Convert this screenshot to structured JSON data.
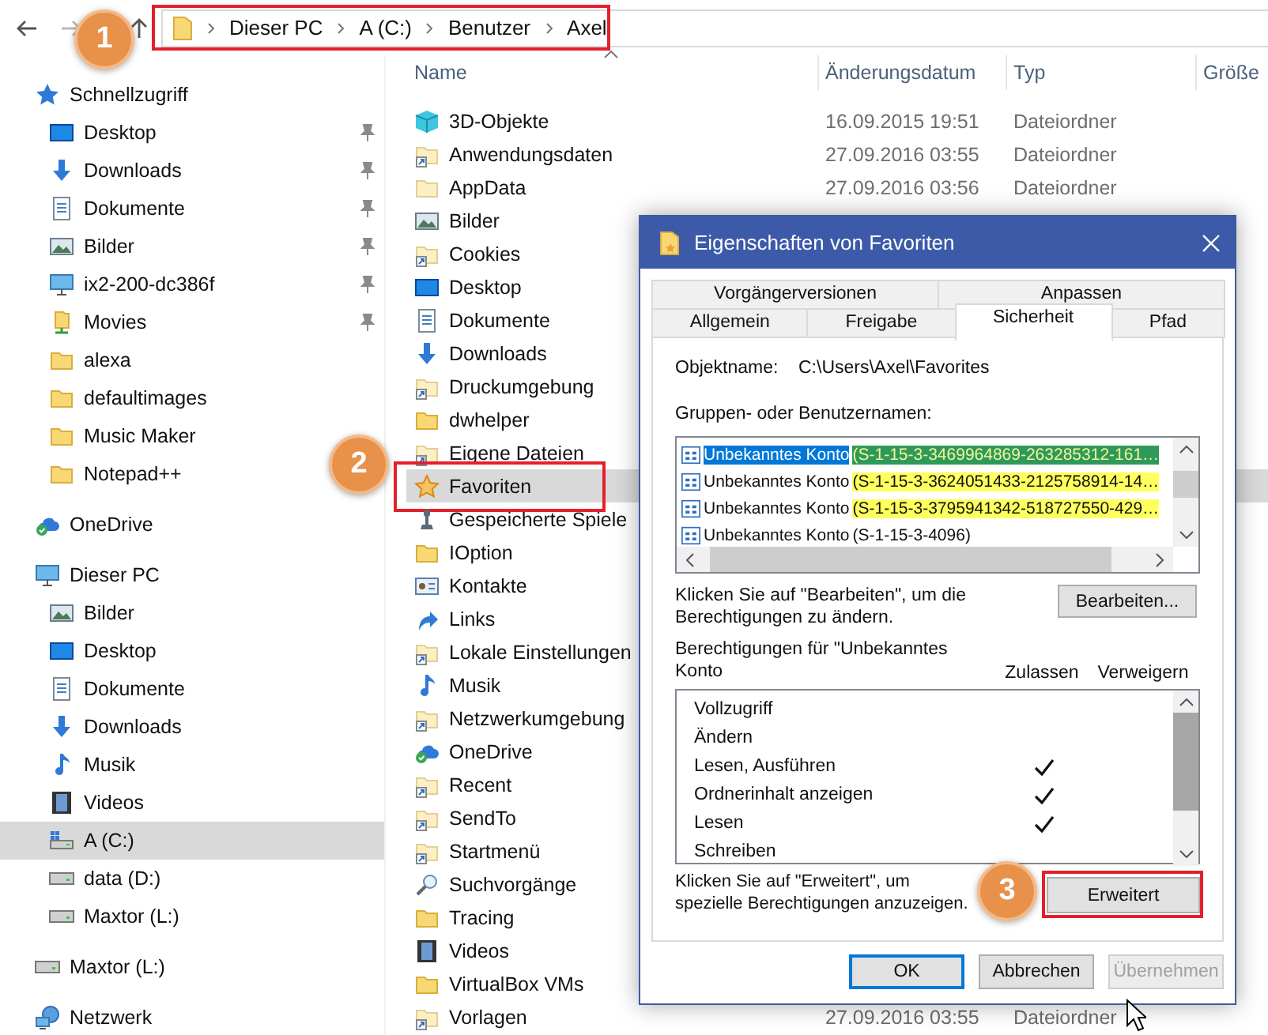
{
  "address_bar": {
    "crumbs": [
      "Dieser PC",
      "A (C:)",
      "Benutzer",
      "Axel"
    ],
    "callout": "1"
  },
  "sidebar": {
    "sections": [
      {
        "label": "Schnellzugriff",
        "kind": "quick-access",
        "selected": false,
        "children": [
          {
            "label": "Desktop",
            "kind": "desktop",
            "pinned": true,
            "selected": false
          },
          {
            "label": "Downloads",
            "kind": "downloads",
            "pinned": true,
            "selected": false
          },
          {
            "label": "Dokumente",
            "kind": "documents",
            "pinned": true,
            "selected": false
          },
          {
            "label": "Bilder",
            "kind": "pictures",
            "pinned": true,
            "selected": false
          },
          {
            "label": "ix2-200-dc386f",
            "kind": "computer",
            "pinned": true,
            "selected": false
          },
          {
            "label": "Movies",
            "kind": "network-folder",
            "pinned": true,
            "selected": false
          },
          {
            "label": "alexa",
            "kind": "folder",
            "pinned": false,
            "selected": false
          },
          {
            "label": "defaultimages",
            "kind": "folder",
            "pinned": false,
            "selected": false
          },
          {
            "label": "Music Maker",
            "kind": "folder",
            "pinned": false,
            "selected": false
          },
          {
            "label": "Notepad++",
            "kind": "folder",
            "pinned": false,
            "selected": false
          }
        ]
      },
      {
        "label": "OneDrive",
        "kind": "cloud",
        "selected": false
      },
      {
        "label": "Dieser PC",
        "kind": "computer",
        "selected": false,
        "children": [
          {
            "label": "Bilder",
            "kind": "pictures",
            "pinned": false,
            "selected": false
          },
          {
            "label": "Desktop",
            "kind": "desktop",
            "pinned": false,
            "selected": false
          },
          {
            "label": "Dokumente",
            "kind": "documents",
            "pinned": false,
            "selected": false
          },
          {
            "label": "Downloads",
            "kind": "downloads",
            "pinned": false,
            "selected": false
          },
          {
            "label": "Musik",
            "kind": "music",
            "pinned": false,
            "selected": false
          },
          {
            "label": "Videos",
            "kind": "videos",
            "pinned": false,
            "selected": false
          },
          {
            "label": "A (C:)",
            "kind": "system-drive",
            "pinned": false,
            "selected": true
          },
          {
            "label": "data (D:)",
            "kind": "drive",
            "pinned": false,
            "selected": false
          },
          {
            "label": "Maxtor (L:)",
            "kind": "drive",
            "pinned": false,
            "selected": false
          }
        ]
      },
      {
        "label": "Maxtor (L:)",
        "kind": "drive",
        "selected": false
      },
      {
        "label": "Netzwerk",
        "kind": "network",
        "selected": false
      }
    ]
  },
  "file_list": {
    "columns": [
      "Name",
      "Änderungsdatum",
      "Typ",
      "Größe"
    ],
    "rows": [
      {
        "name": "3D-Objekte",
        "kind": "cube",
        "date": "16.09.2015 19:51",
        "type": "Dateiordner",
        "selected": false
      },
      {
        "name": "Anwendungsdaten",
        "kind": "shortcut",
        "date": "27.09.2016 03:55",
        "type": "Dateiordner",
        "selected": false
      },
      {
        "name": "AppData",
        "kind": "hidden-folder",
        "date": "27.09.2016 03:56",
        "type": "Dateiordner",
        "selected": false
      },
      {
        "name": "Bilder",
        "kind": "pictures",
        "selected": false
      },
      {
        "name": "Cookies",
        "kind": "shortcut",
        "selected": false
      },
      {
        "name": "Desktop",
        "kind": "desktop",
        "selected": false
      },
      {
        "name": "Dokumente",
        "kind": "documents",
        "selected": false
      },
      {
        "name": "Downloads",
        "kind": "downloads",
        "selected": false
      },
      {
        "name": "Druckumgebung",
        "kind": "shortcut",
        "selected": false
      },
      {
        "name": "dwhelper",
        "kind": "folder",
        "selected": false
      },
      {
        "name": "Eigene Dateien",
        "kind": "shortcut",
        "selected": false
      },
      {
        "name": "Favoriten",
        "kind": "favorites",
        "selected": true,
        "callout": "2"
      },
      {
        "name": "Gespeicherte Spiele",
        "kind": "games",
        "selected": false
      },
      {
        "name": "IOption",
        "kind": "folder",
        "selected": false
      },
      {
        "name": "Kontakte",
        "kind": "contacts",
        "selected": false
      },
      {
        "name": "Links",
        "kind": "links",
        "selected": false
      },
      {
        "name": "Lokale Einstellungen",
        "kind": "shortcut",
        "selected": false
      },
      {
        "name": "Musik",
        "kind": "music",
        "selected": false
      },
      {
        "name": "Netzwerkumgebung",
        "kind": "shortcut",
        "selected": false
      },
      {
        "name": "OneDrive",
        "kind": "cloud",
        "selected": false
      },
      {
        "name": "Recent",
        "kind": "shortcut",
        "selected": false
      },
      {
        "name": "SendTo",
        "kind": "shortcut",
        "selected": false
      },
      {
        "name": "Startmenü",
        "kind": "shortcut",
        "selected": false
      },
      {
        "name": "Suchvorgänge",
        "kind": "search",
        "selected": false
      },
      {
        "name": "Tracing",
        "kind": "folder",
        "selected": false
      },
      {
        "name": "Videos",
        "kind": "videos",
        "selected": false
      },
      {
        "name": "VirtualBox VMs",
        "kind": "folder",
        "selected": false
      },
      {
        "name": "Vorlagen",
        "kind": "shortcut",
        "date": "27.09.2016 03:55",
        "type": "Dateiordner",
        "selected": false
      }
    ]
  },
  "dialog": {
    "title": "Eigenschaften von Favoriten",
    "tab_rows": [
      [
        {
          "label": "Vorgängerversionen",
          "selected": false
        },
        {
          "label": "Anpassen",
          "selected": false
        }
      ],
      [
        {
          "label": "Allgemein",
          "selected": false
        },
        {
          "label": "Freigabe",
          "selected": false
        },
        {
          "label": "Sicherheit",
          "selected": true
        },
        {
          "label": "Pfad",
          "selected": false
        }
      ]
    ],
    "object_label": "Objektname:",
    "object_value": "C:\\Users\\Axel\\Favorites",
    "groups_label": "Gruppen- oder Benutzernamen:",
    "accounts": [
      {
        "name": "Unbekanntes Konto",
        "sid": "(S-1-15-3-3469964869-263285312-161…",
        "selected": true,
        "marked": true
      },
      {
        "name": "Unbekanntes Konto",
        "sid": "(S-1-15-3-3624051433-2125758914-14…",
        "selected": false,
        "marked": true
      },
      {
        "name": "Unbekanntes Konto",
        "sid": "(S-1-15-3-3795941342-518727550-429…",
        "selected": false,
        "marked": true
      },
      {
        "name": "Unbekanntes Konto",
        "sid": "(S-1-15-3-4096)",
        "selected": false,
        "marked": false
      }
    ],
    "edit_hint": "Klicken Sie auf \"Bearbeiten\", um die Berechtigungen zu ändern.",
    "edit_button": "Bearbeiten...",
    "permissions_label": "Berechtigungen für \"Unbekanntes Konto",
    "allow_header": "Zulassen",
    "deny_header": "Verweigern",
    "permissions": [
      {
        "name": "Vollzugriff",
        "allow": false,
        "deny": false
      },
      {
        "name": "Ändern",
        "allow": false,
        "deny": false
      },
      {
        "name": "Lesen, Ausführen",
        "allow": true,
        "deny": false
      },
      {
        "name": "Ordnerinhalt anzeigen",
        "allow": true,
        "deny": false
      },
      {
        "name": "Lesen",
        "allow": true,
        "deny": false
      },
      {
        "name": "Schreiben",
        "allow": false,
        "deny": false
      }
    ],
    "advanced_hint": "Klicken Sie auf \"Erweitert\", um spezielle Berechtigungen anzuzeigen.",
    "advanced_button": {
      "label": "Erweitert",
      "callout": "3"
    },
    "buttons": [
      {
        "label": "OK",
        "default": true,
        "disabled": false
      },
      {
        "label": "Abbrechen",
        "default": false,
        "disabled": false
      },
      {
        "label": "Übernehmen",
        "default": false,
        "disabled": true
      }
    ]
  }
}
